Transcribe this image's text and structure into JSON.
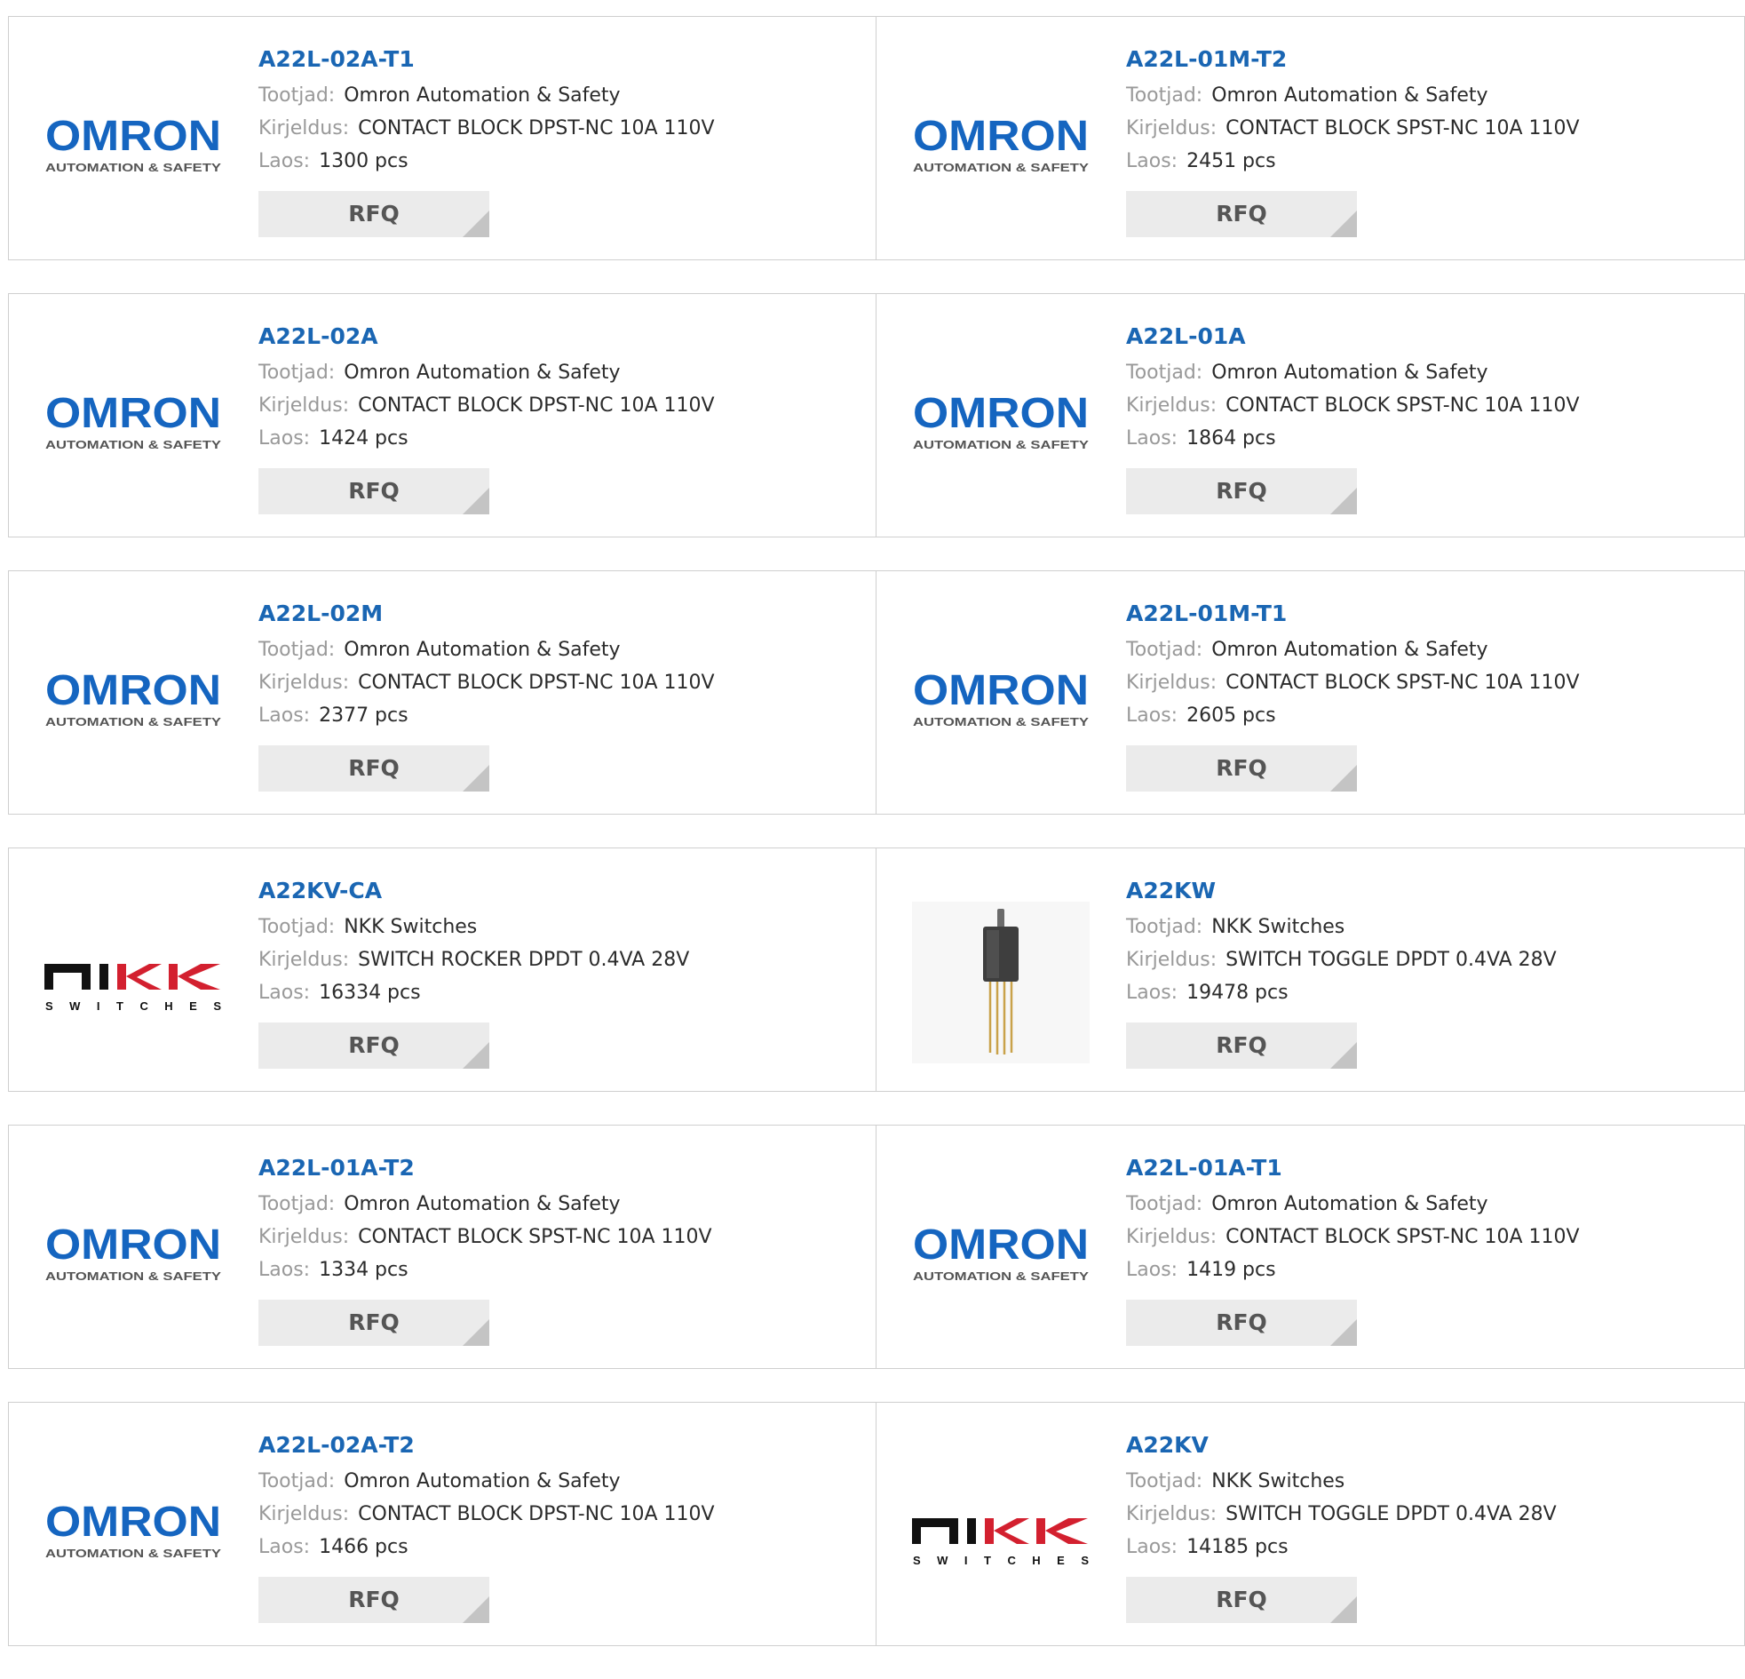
{
  "labels": {
    "manufacturer": "Tootjad:",
    "description": "Kirjeldus:",
    "stock": "Laos:",
    "rfq": "RFQ"
  },
  "brands": {
    "omron": {
      "name": "OMRON",
      "tagline": "AUTOMATION & SAFETY",
      "color": "#1565c0"
    },
    "nkk": {
      "name": "NKK",
      "tagline": "SWITCHES",
      "color": "#111111",
      "accent": "#d3202f"
    }
  },
  "products": [
    {
      "part": "A22L-02A-T1",
      "manufacturer": "Omron Automation & Safety",
      "description": "CONTACT BLOCK DPST-NC 10A 110V",
      "stock": "1300 pcs",
      "logo": "omron"
    },
    {
      "part": "A22L-01M-T2",
      "manufacturer": "Omron Automation & Safety",
      "description": "CONTACT BLOCK SPST-NC 10A 110V",
      "stock": "2451 pcs",
      "logo": "omron"
    },
    {
      "part": "A22L-02A",
      "manufacturer": "Omron Automation & Safety",
      "description": "CONTACT BLOCK DPST-NC 10A 110V",
      "stock": "1424 pcs",
      "logo": "omron"
    },
    {
      "part": "A22L-01A",
      "manufacturer": "Omron Automation & Safety",
      "description": "CONTACT BLOCK SPST-NC 10A 110V",
      "stock": "1864 pcs",
      "logo": "omron"
    },
    {
      "part": "A22L-02M",
      "manufacturer": "Omron Automation & Safety",
      "description": "CONTACT BLOCK DPST-NC 10A 110V",
      "stock": "2377 pcs",
      "logo": "omron"
    },
    {
      "part": "A22L-01M-T1",
      "manufacturer": "Omron Automation & Safety",
      "description": "CONTACT BLOCK SPST-NC 10A 110V",
      "stock": "2605 pcs",
      "logo": "omron"
    },
    {
      "part": "A22KV-CA",
      "manufacturer": "NKK Switches",
      "description": "SWITCH ROCKER DPDT 0.4VA 28V",
      "stock": "16334 pcs",
      "logo": "nkk"
    },
    {
      "part": "A22KW",
      "manufacturer": "NKK Switches",
      "description": "SWITCH TOGGLE DPDT 0.4VA 28V",
      "stock": "19478 pcs",
      "logo": "toggle-switch-photo"
    },
    {
      "part": "A22L-01A-T2",
      "manufacturer": "Omron Automation & Safety",
      "description": "CONTACT BLOCK SPST-NC 10A 110V",
      "stock": "1334 pcs",
      "logo": "omron"
    },
    {
      "part": "A22L-01A-T1",
      "manufacturer": "Omron Automation & Safety",
      "description": "CONTACT BLOCK SPST-NC 10A 110V",
      "stock": "1419 pcs",
      "logo": "omron"
    },
    {
      "part": "A22L-02A-T2",
      "manufacturer": "Omron Automation & Safety",
      "description": "CONTACT BLOCK DPST-NC 10A 110V",
      "stock": "1466 pcs",
      "logo": "omron"
    },
    {
      "part": "A22KV",
      "manufacturer": "NKK Switches",
      "description": "SWITCH TOGGLE DPDT 0.4VA 28V",
      "stock": "14185 pcs",
      "logo": "nkk"
    }
  ]
}
